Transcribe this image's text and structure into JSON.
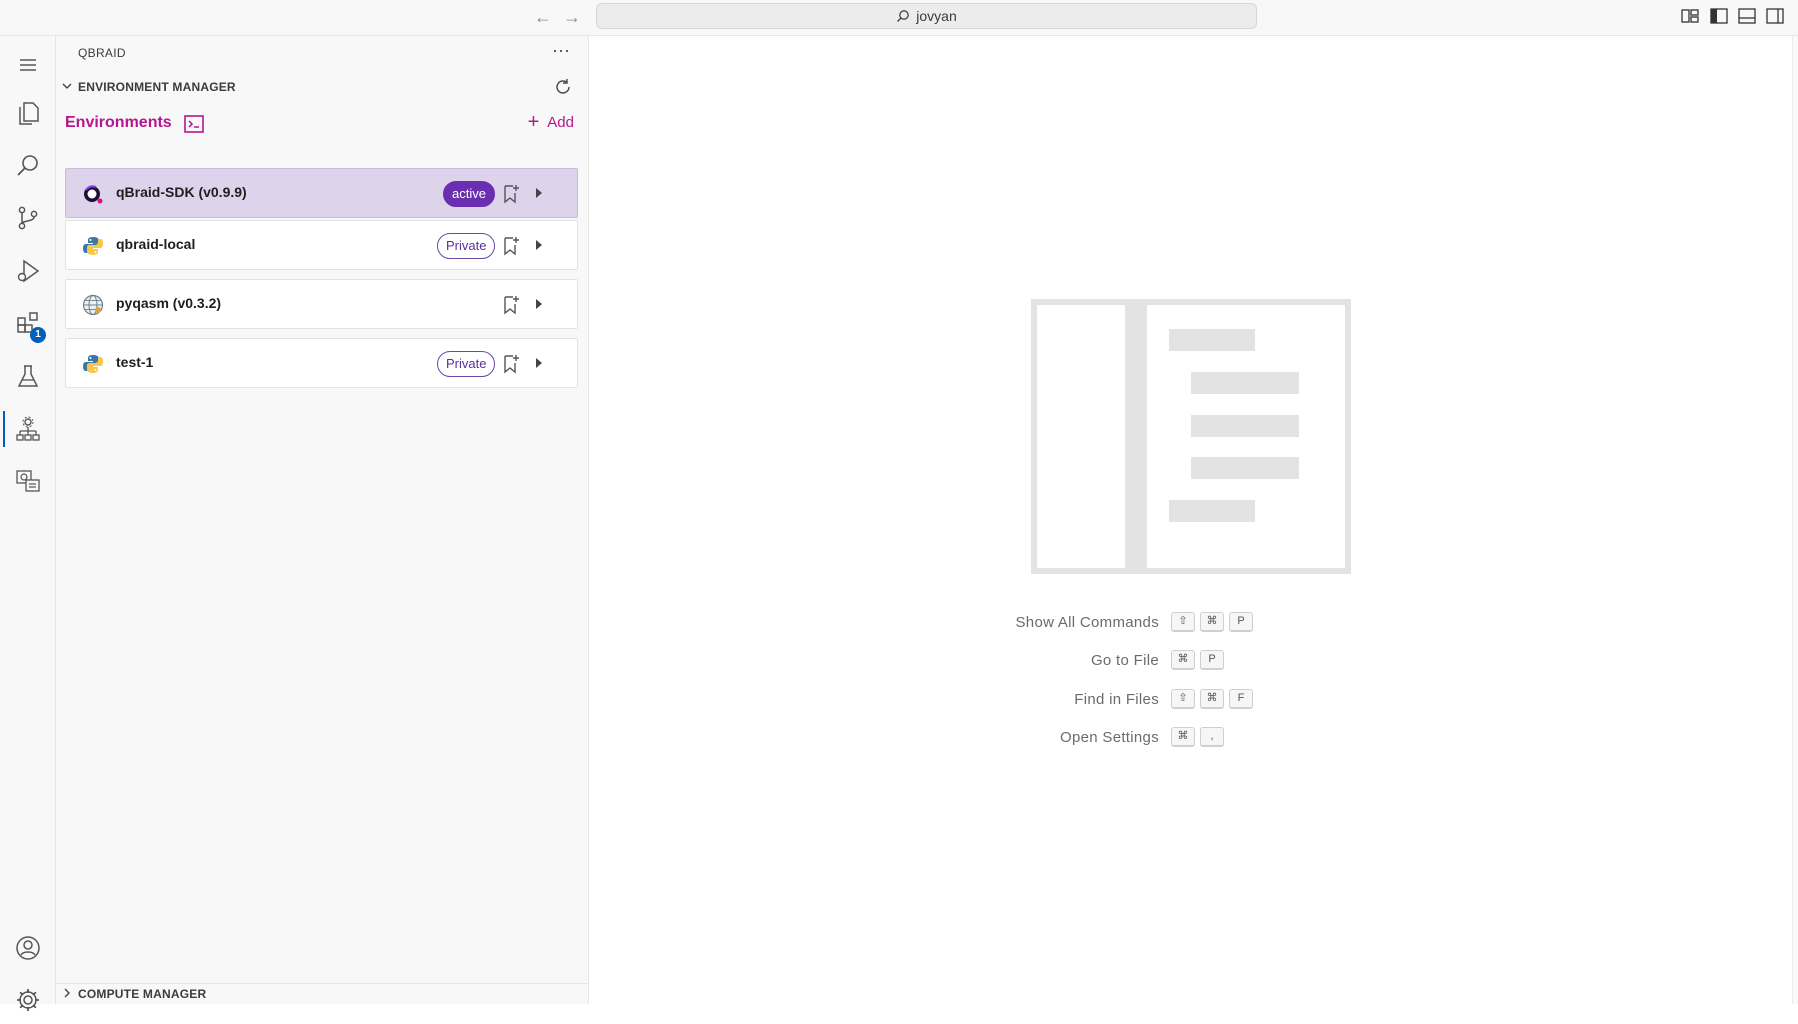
{
  "titlebar": {
    "back_icon": "arrow-left-icon",
    "forward_icon": "arrow-right-icon",
    "search_text": "jovyan",
    "layout_buttons": [
      "customize-layout-icon",
      "toggle-primary-sidebar-icon",
      "toggle-panel-icon",
      "toggle-secondary-sidebar-icon"
    ]
  },
  "activitybar": {
    "items": [
      "menu-icon",
      "explorer-icon",
      "search-icon",
      "source-control-icon",
      "run-debug-icon",
      "extensions-icon",
      "testing-icon",
      "qbraid-env-icon",
      "quantum-devices-icon"
    ],
    "extensions_badge": "1",
    "bottom_items": [
      "account-icon",
      "settings-gear-icon"
    ]
  },
  "sidebar": {
    "title": "QBRAID",
    "more_label": "···",
    "env_section": "ENVIRONMENT MANAGER",
    "environments_title": "Environments",
    "add_label": "Add",
    "compute_section": "COMPUTE MANAGER",
    "environments": [
      {
        "name": "qBraid-SDK (v0.9.9)",
        "tag": "active",
        "icon": "qbraid-logo-icon"
      },
      {
        "name": "qbraid-local",
        "tag": "Private",
        "icon": "python-icon"
      },
      {
        "name": "pyqasm (v0.3.2)",
        "tag": "",
        "icon": "pyqasm-icon"
      },
      {
        "name": "test-1",
        "tag": "Private",
        "icon": "python-icon"
      }
    ]
  },
  "editor": {
    "shortcuts": [
      {
        "label": "Show All Commands",
        "keys": [
          "⇧",
          "⌘",
          "P"
        ]
      },
      {
        "label": "Go to File",
        "keys": [
          "⌘",
          "P"
        ]
      },
      {
        "label": "Find in Files",
        "keys": [
          "⇧",
          "⌘",
          "F"
        ]
      },
      {
        "label": "Open Settings",
        "keys": [
          "⌘",
          ","
        ]
      }
    ]
  },
  "colors": {
    "accent_magenta": "#b5168f",
    "active_pill": "#6a2fb0",
    "active_card": "#ddd3ea",
    "activity_indicator": "#005fb8"
  }
}
